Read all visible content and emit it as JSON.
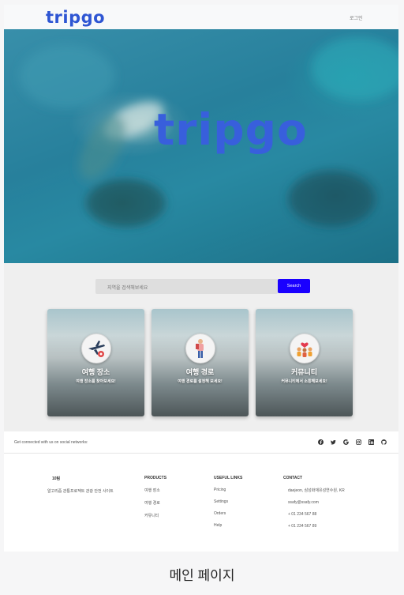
{
  "navbar": {
    "logo": "tripgo",
    "login": "로그인"
  },
  "hero": {
    "logo": "tripgo"
  },
  "search": {
    "placeholder": "지역을 검색해보세요",
    "button": "Search"
  },
  "cards": [
    {
      "title": "여행 장소",
      "subtitle": "여행 장소를 찾아보세요!",
      "icon": "airplane-map-icon"
    },
    {
      "title": "여행 경로",
      "subtitle": "여행 경로를 설정해 보세요!",
      "icon": "traveler-icon"
    },
    {
      "title": "커뮤니티",
      "subtitle": "커뮤니티에서 소통해보세요!",
      "icon": "community-icon"
    }
  ],
  "footer": {
    "social_text": "Get connected with us on social networks:",
    "social_icons": [
      "facebook-icon",
      "twitter-icon",
      "google-icon",
      "instagram-icon",
      "linkedin-icon",
      "github-icon"
    ],
    "brand": {
      "title": "10팀",
      "desc": "알고리즘 관통프로젝트 관광 안전 사이트"
    },
    "products": {
      "title": "PRODUCTS",
      "items": [
        "여행 장소",
        "여행 경로",
        "커뮤니티"
      ]
    },
    "links": {
      "title": "USEFUL LINKS",
      "items": [
        "Pricing",
        "Settings",
        "Orders",
        "Help"
      ]
    },
    "contact": {
      "title": "CONTACT",
      "items": [
        "daejeon, 삼성화재유성연수원, KR",
        "ssafy@ssafy.com",
        "+ 01 234 567 88",
        "+ 01 234 567 89"
      ]
    }
  },
  "caption": "메인 페이지"
}
